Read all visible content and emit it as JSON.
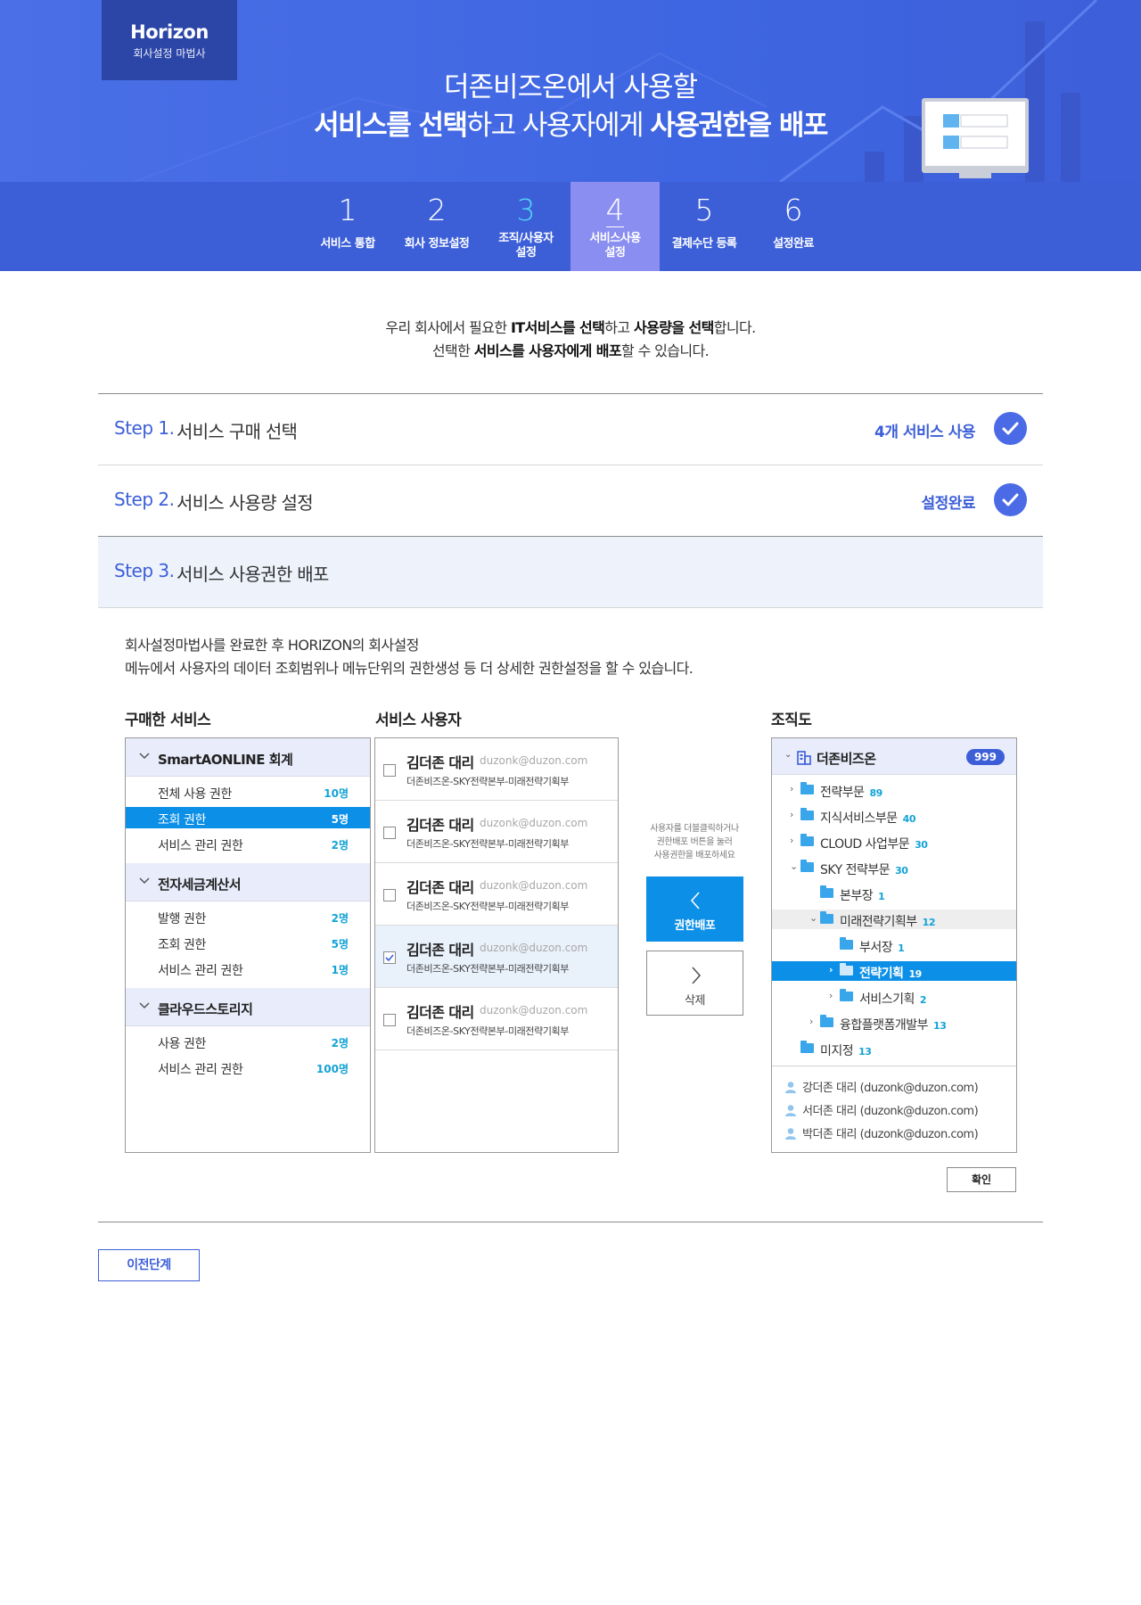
{
  "brand": {
    "name": "Horizon",
    "subtitle": "회사설정 마법사"
  },
  "hero": {
    "line1": "더존비즈온에서 사용할",
    "line2": [
      {
        "text": "서비스를 선택",
        "bold": true
      },
      {
        "text": "하고 사용자에게 ",
        "bold": false
      },
      {
        "text": "사용권한을 배포",
        "bold": true
      }
    ]
  },
  "steps": [
    {
      "num": "1",
      "label": "서비스 통합",
      "state": "done"
    },
    {
      "num": "2",
      "label": "회사 정보설정",
      "state": "done"
    },
    {
      "num": "3",
      "label": "조직/사용자\n설정",
      "state": "current"
    },
    {
      "num": "4",
      "label": "서비스사용\n설정",
      "state": "active"
    },
    {
      "num": "5",
      "label": "결제수단 등록",
      "state": "todo"
    },
    {
      "num": "6",
      "label": "설정완료",
      "state": "todo"
    }
  ],
  "intro": {
    "line1": [
      {
        "text": "우리 회사에서 필요한 ",
        "bold": false
      },
      {
        "text": "IT서비스를 선택",
        "bold": true
      },
      {
        "text": "하고 ",
        "bold": false
      },
      {
        "text": "사용량을 선택",
        "bold": true
      },
      {
        "text": "합니다.",
        "bold": false
      }
    ],
    "line2": [
      {
        "text": "선택한 ",
        "bold": false
      },
      {
        "text": "서비스를 사용자에게 배포",
        "bold": true
      },
      {
        "text": "할 수 있습니다.",
        "bold": false
      }
    ]
  },
  "accordion": [
    {
      "tag": "Step 1.",
      "title": "서비스 구매 선택",
      "status": "4개 서비스 사용",
      "done": true
    },
    {
      "tag": "Step 2.",
      "title": "서비스 사용량 설정",
      "status": "설정완료",
      "done": true
    },
    {
      "tag": "Step 3.",
      "title": "서비스 사용권한 배포",
      "status": "",
      "done": false
    }
  ],
  "description": {
    "line1": "회사설정마법사를 완료한 후 HORIZON의 회사설정",
    "line2": "메뉴에서 사용자의 데이터 조회범위나 메뉴단위의 권한생성 등 더 상세한 권한설정을 할 수 있습니다."
  },
  "columns": {
    "purchased": "구매한 서비스",
    "users": "서비스 사용자",
    "org": "조직도"
  },
  "services": [
    {
      "name": "SmartAONLINE 회계",
      "perms": [
        {
          "name": "전체 사용 권한",
          "count": "10명",
          "selected": false
        },
        {
          "name": "조회 권한",
          "count": "5명",
          "selected": true
        },
        {
          "name": "서비스 관리 권한",
          "count": "2명",
          "selected": false
        }
      ]
    },
    {
      "name": "전자세금계산서",
      "perms": [
        {
          "name": "발행 권한",
          "count": "2명",
          "selected": false
        },
        {
          "name": "조회 권한",
          "count": "5명",
          "selected": false
        },
        {
          "name": "서비스 관리 권한",
          "count": "1명",
          "selected": false
        }
      ]
    },
    {
      "name": "클라우드스토리지",
      "perms": [
        {
          "name": "사용 권한",
          "count": "2명",
          "selected": false
        },
        {
          "name": "서비스 관리 권한",
          "count": "100명",
          "selected": false
        }
      ]
    }
  ],
  "users": [
    {
      "name": "김더존 대리",
      "email": "duzonk@duzon.com",
      "dept": "더존비즈온-SKY전략본부-미래전략기획부",
      "checked": false
    },
    {
      "name": "김더존 대리",
      "email": "duzonk@duzon.com",
      "dept": "더존비즈온-SKY전략본부-미래전략기획부",
      "checked": false
    },
    {
      "name": "김더존 대리",
      "email": "duzonk@duzon.com",
      "dept": "더존비즈온-SKY전략본부-미래전략기획부",
      "checked": false
    },
    {
      "name": "김더존 대리",
      "email": "duzonk@duzon.com",
      "dept": "더존비즈온-SKY전략본부-미래전략기획부",
      "checked": true
    },
    {
      "name": "김더존 대리",
      "email": "duzonk@duzon.com",
      "dept": "더존비즈온-SKY전략본부-미래전략기획부",
      "checked": false
    }
  ],
  "middle": {
    "hint": "사용자를 더블클릭하거나\n권한배포 버튼을 눌러\n사용권한을 배포하세요",
    "grant_label": "권한배포",
    "delete_label": "삭제"
  },
  "org": {
    "root_name": "더존비즈온",
    "root_count": "999",
    "nodes": [
      {
        "name": "전략부문",
        "count": "89",
        "level": 0,
        "toggle": "collapsed",
        "state": ""
      },
      {
        "name": "지식서비스부문",
        "count": "40",
        "level": 0,
        "toggle": "collapsed",
        "state": ""
      },
      {
        "name": "CLOUD 사업부문",
        "count": "30",
        "level": 0,
        "toggle": "collapsed",
        "state": ""
      },
      {
        "name": "SKY 전략부문",
        "count": "30",
        "level": 0,
        "toggle": "expanded",
        "state": ""
      },
      {
        "name": "본부장",
        "count": "1",
        "level": 1,
        "toggle": "none",
        "state": ""
      },
      {
        "name": "미래전략기획부",
        "count": "12",
        "level": 1,
        "toggle": "expanded",
        "state": "hover"
      },
      {
        "name": "부서장",
        "count": "1",
        "level": 2,
        "toggle": "none",
        "state": ""
      },
      {
        "name": "전략기획",
        "count": "19",
        "level": 2,
        "toggle": "collapsed",
        "state": "selected"
      },
      {
        "name": "서비스기획",
        "count": "2",
        "level": 2,
        "toggle": "collapsed",
        "state": ""
      },
      {
        "name": "융합플랫폼개발부",
        "count": "13",
        "level": 1,
        "toggle": "collapsed",
        "state": ""
      },
      {
        "name": "미지정",
        "count": "13",
        "level": 0,
        "toggle": "none",
        "state": ""
      }
    ],
    "members": [
      {
        "label": "강더존 대리 (duzonk@duzon.com)"
      },
      {
        "label": "서더존 대리 (duzonk@duzon.com)"
      },
      {
        "label": "박더존 대리 (duzonk@duzon.com)"
      }
    ]
  },
  "confirm_label": "확인",
  "prev_label": "이전단계",
  "colors": {
    "primary": "#3c5fd8",
    "accent": "#0c8fe7",
    "count": "#12a3d6",
    "active_step": "#8a8ef0"
  }
}
